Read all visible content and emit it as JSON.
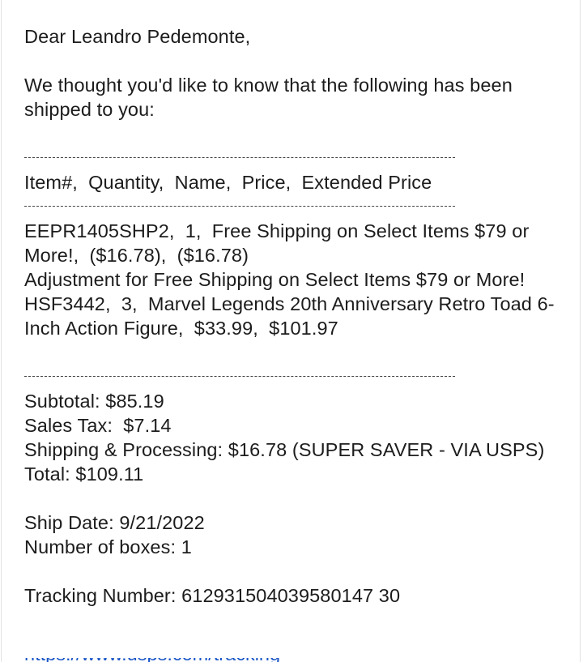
{
  "email": {
    "greeting": "Dear Leandro Pedemonte,",
    "intro": "We thought you'd like to know that the following has been shipped to you:",
    "table_header": "Item#,  Quantity,  Name,  Price,  Extended Price",
    "items": [
      "EEPR1405SHP2,  1,  Free Shipping on Select Items $79 or More!,  ($16.78),  ($16.78)",
      "Adjustment for Free Shipping on Select Items $79 or More!",
      "HSF3442,  3,  Marvel Legends 20th Anniversary Retro Toad 6-Inch Action Figure,  $33.99,  $101.97"
    ],
    "subtotal": "Subtotal: $85.19",
    "sales_tax": "Sales Tax:  $7.14",
    "shipping": "Shipping & Processing: $16.78 (SUPER SAVER - VIA USPS)",
    "total": "Total: $109.11",
    "ship_date": "Ship Date: 9/21/2022",
    "boxes": "Number of boxes: 1",
    "tracking": "Tracking Number: 612931504039580147 30"
  }
}
